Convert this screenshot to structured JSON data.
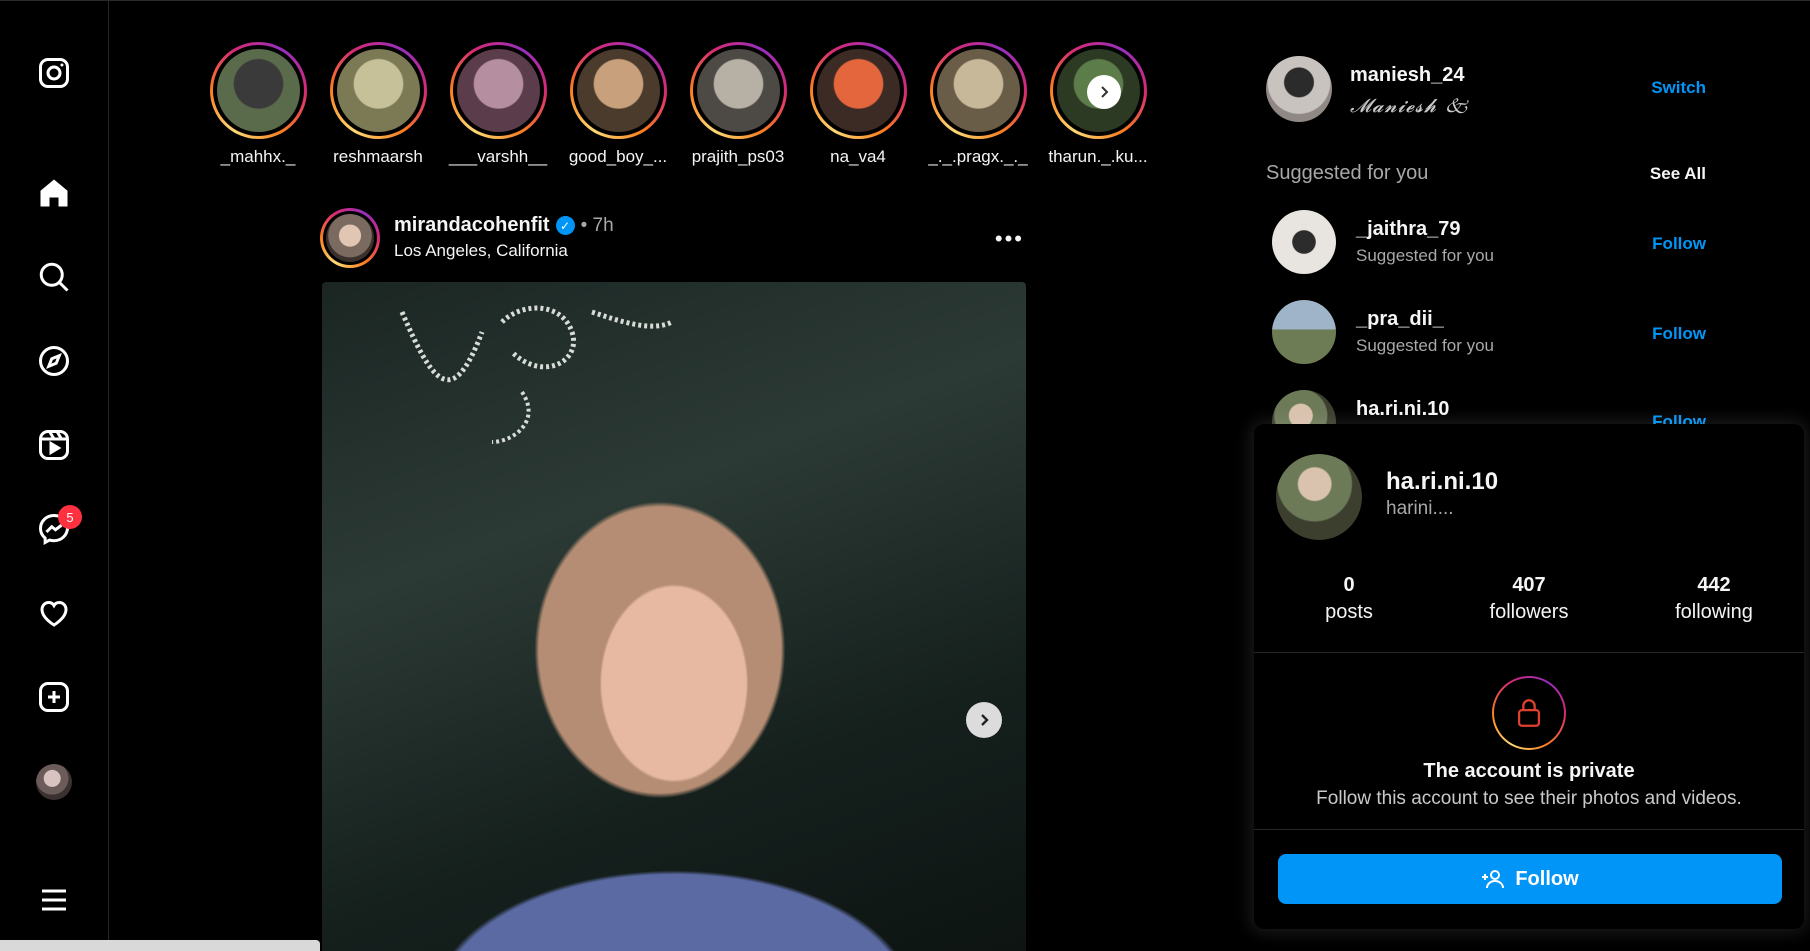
{
  "stories": [
    {
      "username": "_mahhx._",
      "color_a": "#3a3a3a",
      "color_b": "#5a6b4c"
    },
    {
      "username": "reshmaarsh",
      "color_a": "#c7c19a",
      "color_b": "#7b7a55"
    },
    {
      "username": "___varshh__",
      "color_a": "#b58fa0",
      "color_b": "#5a3c4a"
    },
    {
      "username": "good_boy_...",
      "color_a": "#c9a07c",
      "color_b": "#4a3b2c"
    },
    {
      "username": "prajith_ps03",
      "color_a": "#b6b0a5",
      "color_b": "#4d4a45"
    },
    {
      "username": "na_va4",
      "color_a": "#e4663d",
      "color_b": "#3c2b25"
    },
    {
      "username": "_._.pragx._._",
      "color_a": "#c7b89a",
      "color_b": "#6a5d48"
    },
    {
      "username": "tharun._.ku...",
      "color_a": "#5c7c4a",
      "color_b": "#2c3a24"
    }
  ],
  "post": {
    "username": "mirandacohenfit",
    "time": "• 7h",
    "location": "Los Angeles, California"
  },
  "account": {
    "username": "maniesh_24",
    "display_name": "𝓜𝓪𝓷𝓲𝓮𝓼𝓱 🙵",
    "switch_label": "Switch"
  },
  "suggestions": {
    "title": "Suggested for you",
    "see_all": "See All",
    "items": [
      {
        "username": "_jaithra_79",
        "subtitle": "Suggested for you",
        "action": "Follow",
        "color_a": "#e8e4e0",
        "color_b": "#2c2c2c"
      },
      {
        "username": "_pra_dii_",
        "subtitle": "Suggested for you",
        "action": "Follow",
        "color_a": "#9fb3c9",
        "color_b": "#5b6b45"
      },
      {
        "username": "ha.ri.ni.10",
        "subtitle": "",
        "action": "Follow",
        "color_a": "#d9c2ae",
        "color_b": "#4c5438"
      }
    ]
  },
  "hover_card": {
    "username": "ha.ri.ni.10",
    "full_name": "harini....",
    "stats": [
      {
        "value": "0",
        "label": "posts"
      },
      {
        "value": "407",
        "label": "followers"
      },
      {
        "value": "442",
        "label": "following"
      }
    ],
    "private_title": "The account is private",
    "private_text": "Follow this account to see their photos and videos.",
    "follow_label": "Follow"
  },
  "nav": {
    "messages_badge": "5"
  },
  "colors": {
    "accent": "#0095f6",
    "badge": "#ff3040",
    "background": "#000000"
  }
}
